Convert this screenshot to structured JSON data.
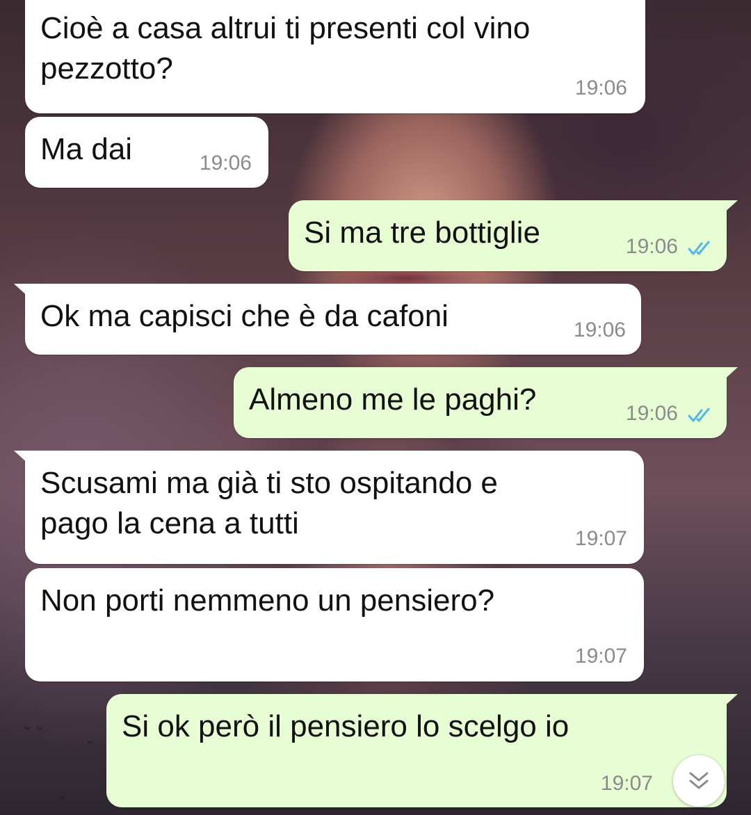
{
  "messages": [
    {
      "direction": "in",
      "text": "Cioè a casa altrui ti presenti col vino\npezzotto?",
      "time": "19:06"
    },
    {
      "direction": "in",
      "text": "Ma dai",
      "time": "19:06"
    },
    {
      "direction": "out",
      "text": "Si ma tre bottiglie",
      "time": "19:06",
      "status": "read"
    },
    {
      "direction": "in",
      "text": "Ok ma capisci che è da cafoni",
      "time": "19:06"
    },
    {
      "direction": "out",
      "text": "Almeno me le paghi?",
      "time": "19:06",
      "status": "read"
    },
    {
      "direction": "in",
      "text": "Scusami ma già ti sto ospitando e\npago la cena a tutti",
      "time": "19:07"
    },
    {
      "direction": "in",
      "text": "Non porti nemmeno un pensiero?",
      "time": "19:07"
    },
    {
      "direction": "out",
      "text": "Si ok però il pensiero lo scelgo io",
      "time": "19:07"
    }
  ],
  "colors": {
    "incoming_bubble": "#ffffff",
    "outgoing_bubble": "#e7fdd3",
    "timestamp": "#8b8b8b",
    "read_ticks": "#4fb6ec"
  },
  "icons": {
    "read_receipt": "double-check-icon",
    "scroll_down": "chevron-down-double-icon"
  }
}
